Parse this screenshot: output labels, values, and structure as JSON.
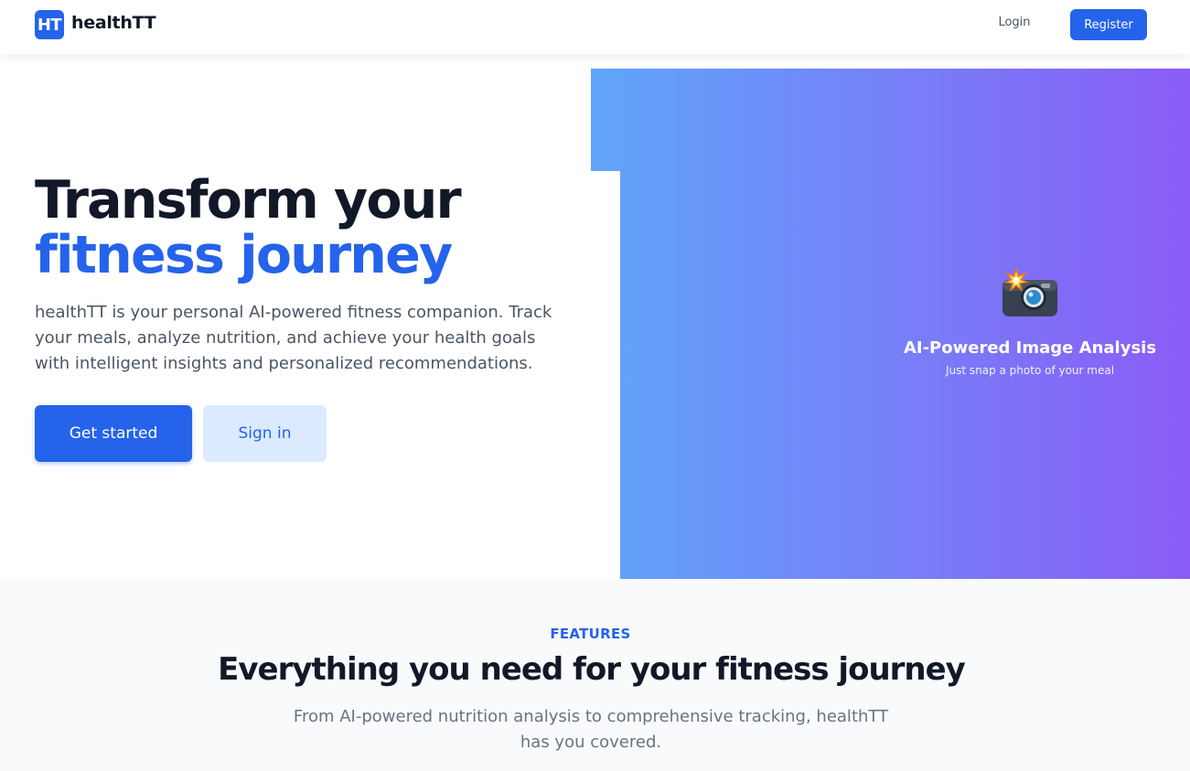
{
  "colors": {
    "primary": "#2563eb",
    "primary_light": "#dbeafe",
    "gradient_start": "#60a5fa",
    "gradient_end": "#8b5cf6",
    "text_dark": "#111827",
    "text_muted": "#4b5563"
  },
  "header": {
    "logo_text": "HT",
    "brand": "healthTT",
    "login_label": "Login",
    "register_label": "Register"
  },
  "hero": {
    "title_line1": "Transform your",
    "title_line2": "fitness journey",
    "description": "healthTT is your personal AI-powered fitness companion. Track your meals, analyze nutrition, and achieve your health goals with intelligent insights and personalized recommendations.",
    "get_started_label": "Get started",
    "sign_in_label": "Sign in",
    "visual": {
      "icon": "camera-flash-icon",
      "title": "AI-Powered Image Analysis",
      "subtitle": "Just snap a photo of your meal"
    }
  },
  "features": {
    "eyebrow": "FEATURES",
    "title": "Everything you need for your fitness journey",
    "description": "From AI-powered nutrition analysis to comprehensive tracking, healthTT has you covered."
  }
}
